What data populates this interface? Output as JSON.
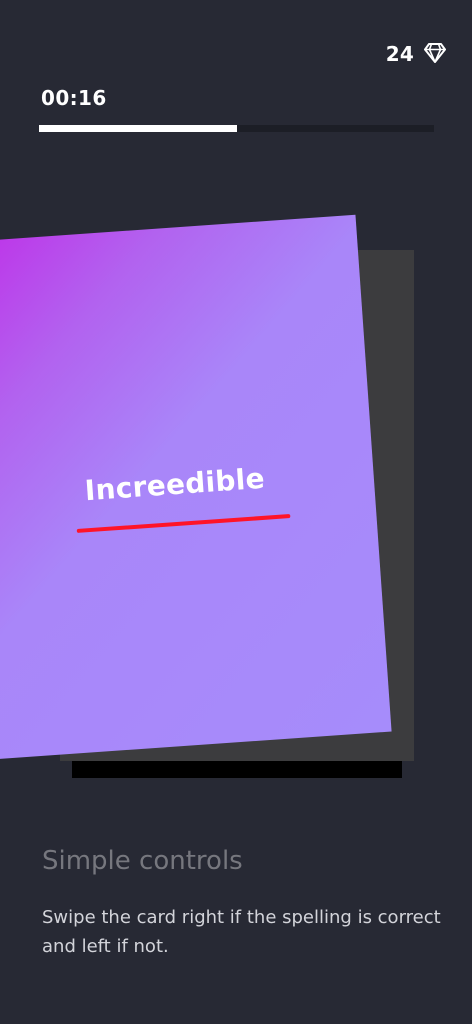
{
  "header": {
    "gem_count": "24",
    "gem_icon": "diamond-icon",
    "timer": "00:16",
    "progress_fraction": 0.5
  },
  "card": {
    "word": "Increedible",
    "underline_color": "#ff1428",
    "gradient_start": "#bf2fe8",
    "gradient_end": "#a68cfb"
  },
  "info": {
    "title": "Simple controls",
    "body": "Swipe the card right if the spelling is correct and left if not."
  },
  "colors": {
    "background": "#272934",
    "back_card": "#3c3c3e",
    "progress_track": "#1c1e26"
  }
}
